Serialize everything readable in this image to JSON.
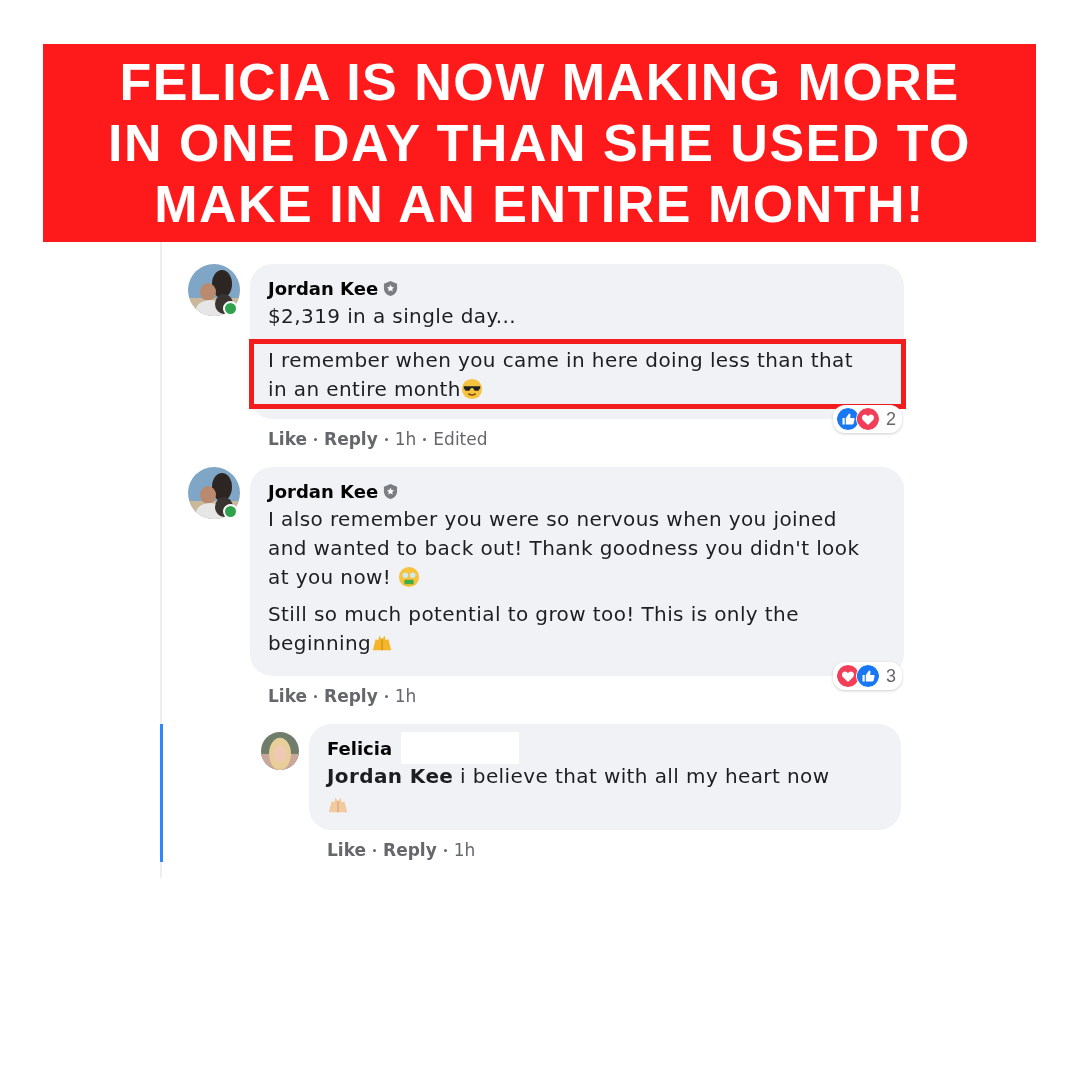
{
  "banner": {
    "lines": [
      "FELICIA IS NOW MAKING MORE",
      "IN ONE DAY THAN SHE USED TO",
      "MAKE IN AN ENTIRE MONTH!"
    ]
  },
  "comments": [
    {
      "author": "Jordan Kee",
      "badge": true,
      "online": true,
      "reply": false,
      "paragraphs": [
        {
          "text": "$2,319 in a single day...",
          "highlighted": false
        },
        {
          "text": "I remember when you came in here doing less than that in an entire month",
          "highlighted": true,
          "emoji": {
            "kind": "sunglasses"
          }
        }
      ],
      "reactions": {
        "icons": [
          {
            "kind": "like"
          },
          {
            "kind": "love"
          }
        ],
        "count": "2"
      },
      "actions": {
        "like": "Like",
        "reply": "Reply",
        "time": "1h",
        "edited": "Edited"
      }
    },
    {
      "author": "Jordan Kee",
      "badge": true,
      "online": true,
      "reply": false,
      "paragraphs": [
        {
          "text": "I also remember you were so nervous when you joined and wanted to back out! Thank goodness you didn't look at you now! ",
          "highlighted": false,
          "emoji": {
            "kind": "money"
          }
        },
        {
          "text": "Still so much potential to grow too! This is only the beginning",
          "highlighted": false,
          "emoji": {
            "kind": "hands"
          }
        }
      ],
      "reactions": {
        "icons": [
          {
            "kind": "love"
          },
          {
            "kind": "like"
          }
        ],
        "count": "3"
      },
      "actions": {
        "like": "Like",
        "reply": "Reply",
        "time": "1h"
      }
    },
    {
      "author": "Felicia",
      "badge": false,
      "online": false,
      "reply": true,
      "paragraphs": [
        {
          "text": "**Jordan Kee** i believe that with all my heart now ",
          "highlighted": false,
          "emoji": {
            "kind": "hands_light"
          }
        }
      ],
      "actions": {
        "like": "Like",
        "reply": "Reply",
        "time": "1h"
      }
    }
  ]
}
